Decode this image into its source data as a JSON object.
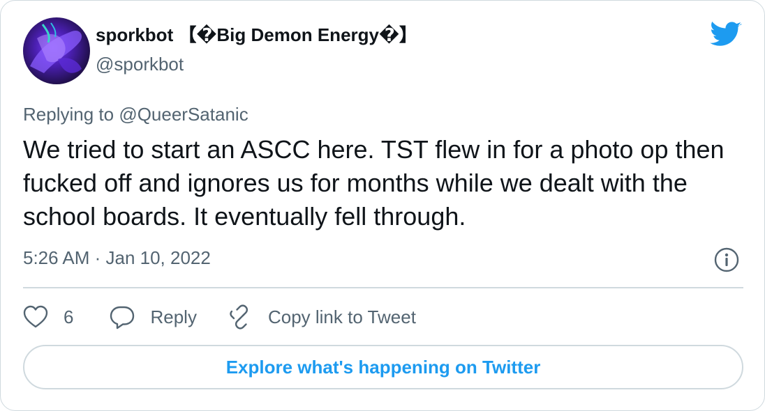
{
  "author": {
    "display_name": "sporkbot 【�Big Demon Energy�】",
    "handle": "@sporkbot"
  },
  "tweet": {
    "replying_prefix": "Replying to ",
    "replying_to": "@QueerSatanic",
    "text": "We tried to start an ASCC here. TST flew in for a photo op then fucked off and ignores us for months while we dealt with the school boards. It eventually fell through.",
    "timestamp": "5:26 AM · Jan 10, 2022"
  },
  "actions": {
    "like_count": "6",
    "reply_label": "Reply",
    "copy_label": "Copy link to Tweet"
  },
  "explore_label": "Explore what's happening on Twitter",
  "colors": {
    "brand": "#1d9bf0",
    "secondary_text": "#536471",
    "border": "#cfd9de",
    "primary_text": "#0f1419"
  },
  "icons": {
    "brand": "twitter-bird-icon",
    "info": "info-icon",
    "like": "heart-icon",
    "reply": "speech-bubble-icon",
    "copy": "link-icon"
  }
}
